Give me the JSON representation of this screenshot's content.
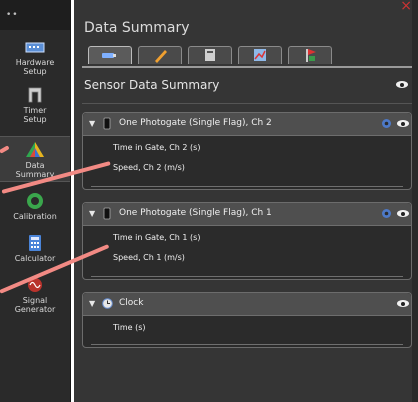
{
  "sidebar": {
    "items": [
      {
        "label": "Hardware\nSetup",
        "icon": "hardware-icon"
      },
      {
        "label": "Timer\nSetup",
        "icon": "timer-icon"
      },
      {
        "label": "Data\nSummary",
        "icon": "data-summary-icon"
      },
      {
        "label": "Calibration",
        "icon": "calibration-icon"
      },
      {
        "label": "Calculator",
        "icon": "calculator-icon"
      },
      {
        "label": "Signal\nGenerator",
        "icon": "signal-generator-icon"
      }
    ]
  },
  "panel": {
    "title": "Data Summary",
    "section_heading": "Sensor Data Summary",
    "tabs": [
      "sensor-tab-icon",
      "pencil-tab-icon",
      "calculator-tab-icon",
      "graph-tab-icon",
      "flag-tab-icon"
    ]
  },
  "cards": [
    {
      "title": "One Photogate (Single Flag), Ch 2",
      "rows": [
        "Time in Gate, Ch 2 (s)",
        "Speed, Ch 2 (m/s)"
      ],
      "selected_row": 1
    },
    {
      "title": "One Photogate (Single Flag), Ch 1",
      "rows": [
        "Time in Gate, Ch 1 (s)",
        "Speed, Ch 1 (m/s)"
      ],
      "selected_row": -1
    },
    {
      "title": "Clock",
      "rows": [
        "Time (s)"
      ],
      "selected_row": -1
    }
  ],
  "colors": {
    "accent": "#f28a84",
    "panel_bg": "#353535",
    "card_head": "#4f4f4f"
  }
}
